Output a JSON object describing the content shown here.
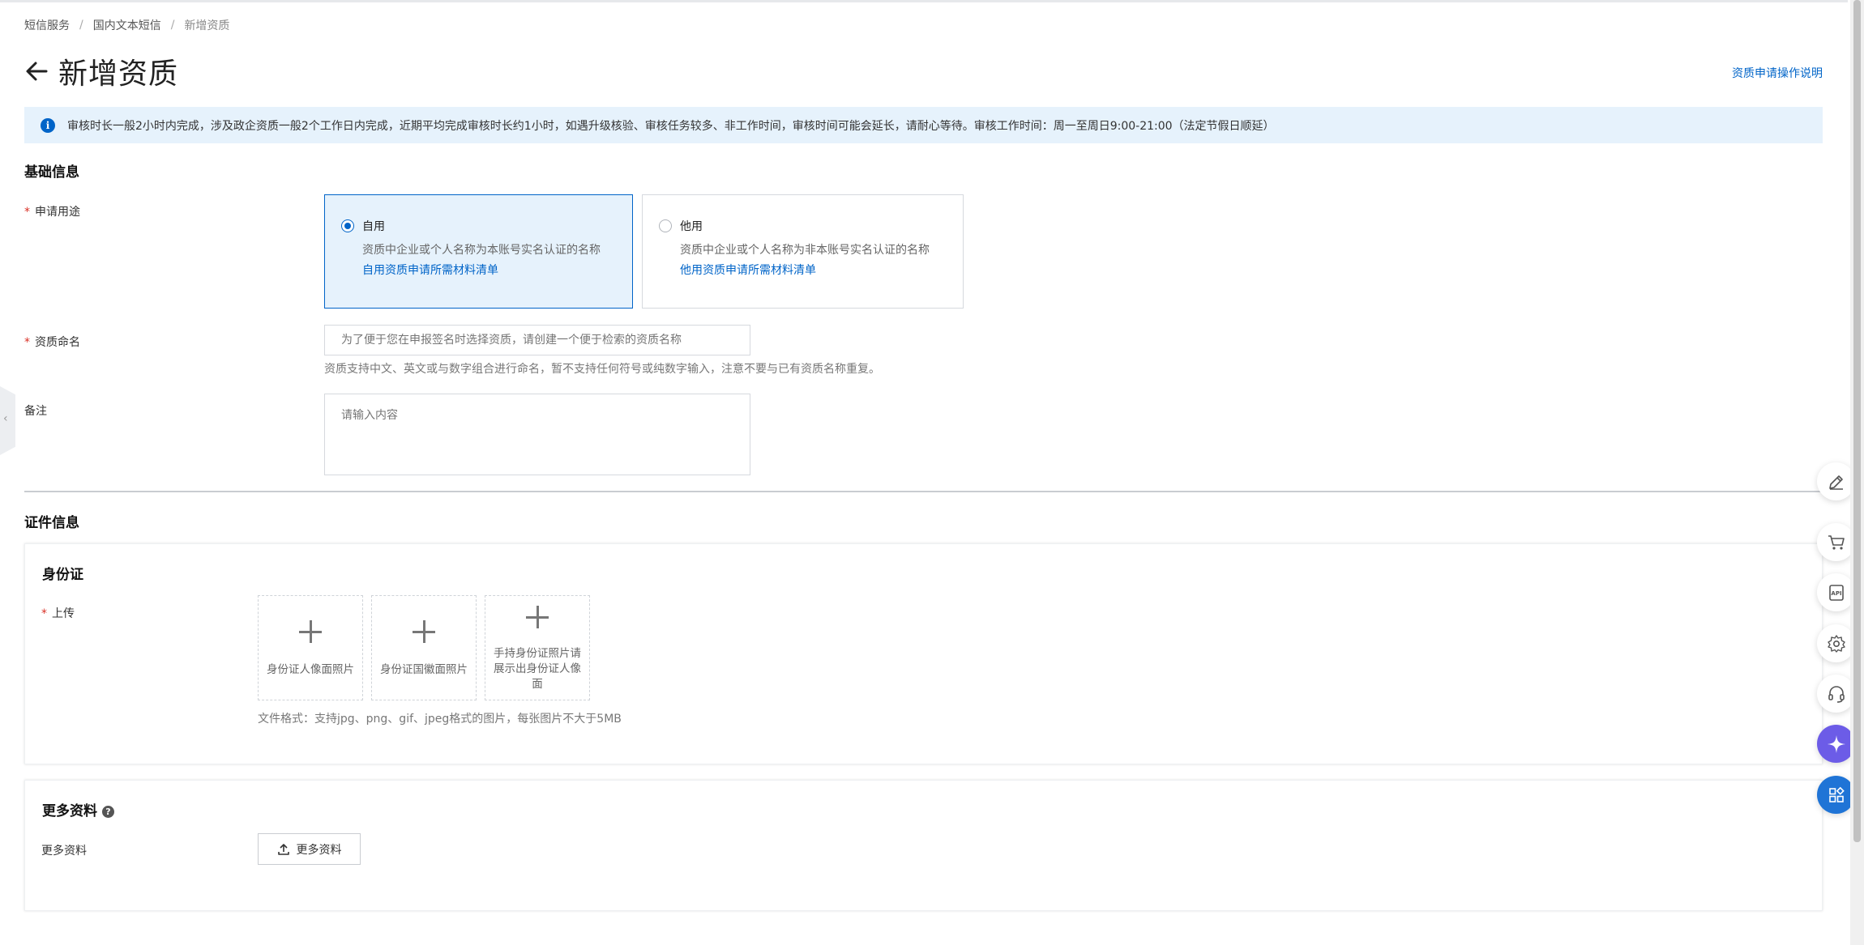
{
  "breadcrumb": {
    "items": [
      "短信服务",
      "国内文本短信"
    ],
    "current": "新增资质"
  },
  "header": {
    "title": "新增资质",
    "help_link": "资质申请操作说明"
  },
  "notice": {
    "text": "审核时长一般2小时内完成，涉及政企资质一般2个工作日内完成，近期平均完成审核时长约1小时，如遇升级核验、审核任务较多、非工作时间，审核时间可能会延长，请耐心等待。审核工作时间：周一至周日9:00-21:00（法定节假日顺延）"
  },
  "basic_info": {
    "section_title": "基础信息",
    "usage": {
      "label": "申请用途",
      "options": [
        {
          "title": "自用",
          "desc": "资质中企业或个人名称为本账号实名认证的名称",
          "link": "自用资质申请所需材料清单",
          "selected": true
        },
        {
          "title": "他用",
          "desc": "资质中企业或个人名称为非本账号实名认证的名称",
          "link": "他用资质申请所需材料清单",
          "selected": false
        }
      ]
    },
    "name": {
      "label": "资质命名",
      "placeholder": "为了便于您在申报签名时选择资质，请创建一个便于检索的资质名称",
      "hint": "资质支持中文、英文或与数字组合进行命名，暂不支持任何符号或纯数字输入，注意不要与已有资质名称重复。"
    },
    "remark": {
      "label": "备注",
      "placeholder": "请输入内容"
    }
  },
  "cert_info": {
    "section_title": "证件信息",
    "id_card": {
      "title": "身份证",
      "upload_label": "上传",
      "boxes": [
        {
          "caption": "身份证人像面照片"
        },
        {
          "caption": "身份证国徽面照片"
        },
        {
          "caption": "手持身份证照片请展示出身份证人像面"
        }
      ],
      "format_hint": "文件格式：支持jpg、png、gif、jpeg格式的图片，每张图片不大于5MB"
    },
    "more": {
      "title": "更多资料",
      "label": "更多资料",
      "button": "更多资料"
    }
  },
  "floating_tools": [
    "edit-icon",
    "cart-icon",
    "api-icon",
    "settings-icon",
    "support-icon",
    "ai-assistant-icon",
    "apps-icon"
  ],
  "colors": {
    "accent": "#0064c8",
    "notice_bg": "#e6f2fc",
    "required": "#d93026",
    "ai_button": "#6c5ce7",
    "apps_button": "#1f74d6"
  }
}
